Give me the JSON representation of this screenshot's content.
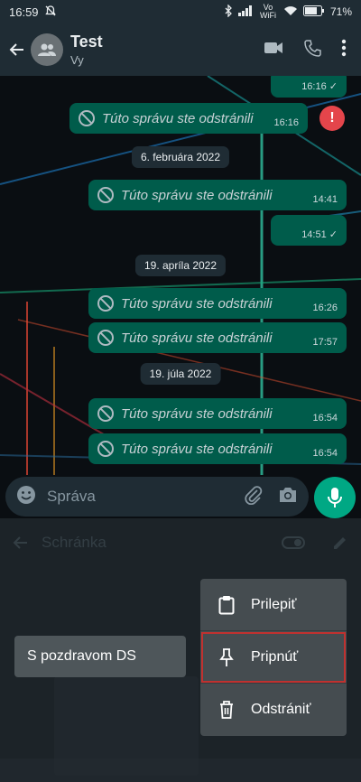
{
  "status": {
    "time": "16:59",
    "network": "Vo WiFi",
    "battery": "71%"
  },
  "header": {
    "title": "Test",
    "subtitle": "Vy"
  },
  "chat": {
    "deleted_text": "Túto správu ste odstránili",
    "top_time": "16:16",
    "messages": [
      {
        "time": "16:16"
      },
      {
        "time": "14:41"
      },
      {
        "time": "14:51"
      },
      {
        "time": "16:26"
      },
      {
        "time": "17:57"
      },
      {
        "time": "16:54"
      },
      {
        "time": "16:54"
      }
    ],
    "dates": [
      "6. februára 2022",
      "19. apríla 2022",
      "19. júla 2022"
    ],
    "error_mark": "!"
  },
  "input": {
    "placeholder": "Správa"
  },
  "panel": {
    "ghost_title": "Schránka",
    "clip_text": "S pozdravom DS",
    "menu": {
      "paste": "Prilepiť",
      "pin": "Pripnúť",
      "delete": "Odstrániť"
    }
  },
  "colors": {
    "accent": "#00a884",
    "bubble": "#005c4b",
    "highlight": "#c0312f",
    "error": "#e4454b"
  }
}
